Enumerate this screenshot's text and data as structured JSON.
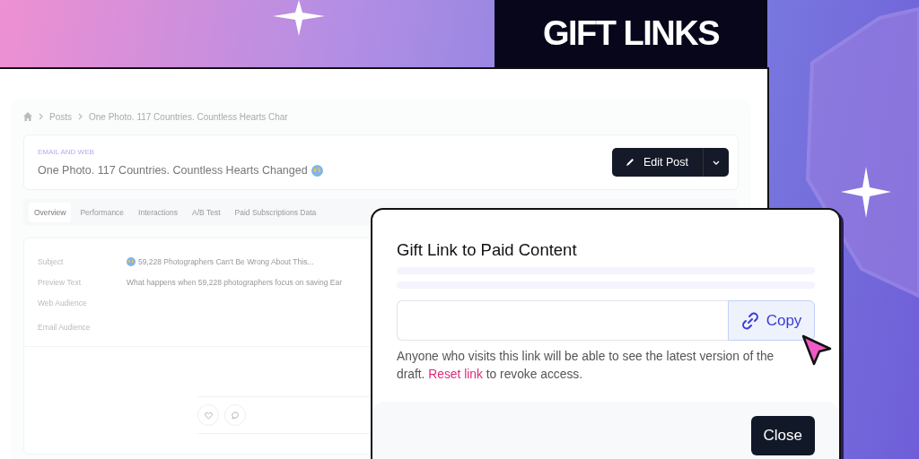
{
  "banner": {
    "title": "GIFT LINKS"
  },
  "breadcrumb": [
    "Posts",
    "One Photo. 117 Countries. Countless Hearts Char"
  ],
  "post": {
    "type_label": "EMAIL AND WEB",
    "title": "One Photo. 117 Countries. Countless Hearts Changed",
    "edit_button": "Edit Post"
  },
  "tabs": [
    {
      "label": "Overview",
      "selected": true
    },
    {
      "label": "Performance",
      "selected": false
    },
    {
      "label": "Interactions",
      "selected": false
    },
    {
      "label": "A/B Test",
      "selected": false
    },
    {
      "label": "Paid Subscriptions Data",
      "selected": false
    }
  ],
  "details": [
    {
      "label": "Subject",
      "kind": "emoji",
      "value": "59,228 Photographers Can't Be Wrong About This..."
    },
    {
      "label": "Preview Text",
      "kind": "plain",
      "value": "What happens when 59,228 photographers focus on saving Ear"
    },
    {
      "label": "Web Audience"
    },
    {
      "label": "Email Audience"
    }
  ],
  "modal": {
    "title": "Gift Link to Paid Content",
    "copy_button": "Copy",
    "note_before": "Anyone who visits this link will be able to see the latest version of the draft. ",
    "reset_link": "Reset link",
    "note_after": " to revoke access.",
    "close_button": "Close"
  }
}
